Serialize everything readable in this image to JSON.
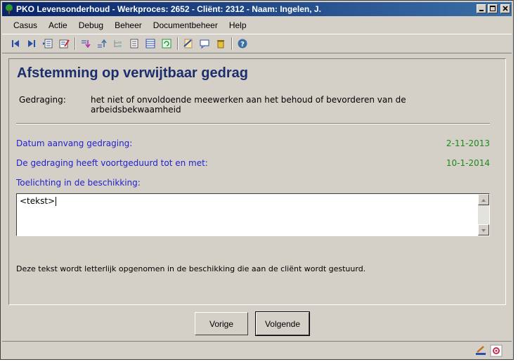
{
  "window": {
    "title": "PKO Levensonderhoud - Werkproces: 2652 - Cliënt: 2312 - Naam: Ingelen, J."
  },
  "menu": [
    "Casus",
    "Actie",
    "Debug",
    "Beheer",
    "Documentbeheer",
    "Help"
  ],
  "toolbar": {
    "icons": [
      "first-record-icon",
      "last-record-icon",
      "open-list-icon",
      "edit-icon",
      "move-down-icon",
      "sort-icon",
      "tree-icon",
      "document-icon",
      "list-icon",
      "refresh-icon",
      "notes-icon",
      "comment-icon",
      "trash-icon",
      "help-icon"
    ]
  },
  "page": {
    "title": "Afstemming op verwijtbaar gedrag",
    "gedraging_label": "Gedraging:",
    "gedraging_value": "het niet of onvoldoende meewerken aan het behoud of bevorderen van de arbeidsbekwaamheid",
    "datum_label": "Datum aanvang gedraging:",
    "datum_value": "2-11-2013",
    "voortgeduurd_label": "De gedraging heeft voortgeduurd tot en met:",
    "voortgeduurd_value": "10-1-2014",
    "toelichting_label": "Toelichting in de beschikking:",
    "toelichting_value": "<tekst>",
    "note": "Deze tekst wordt letterlijk opgenomen in de beschikking die aan de cliënt wordt gestuurd."
  },
  "buttons": {
    "prev": "Vorige",
    "next": "Volgende"
  },
  "colors": {
    "title_bar": "#0a246a",
    "page_title": "#1c2e6b",
    "label_blue": "#1f1fd2",
    "value_green": "#1a8a1a"
  }
}
